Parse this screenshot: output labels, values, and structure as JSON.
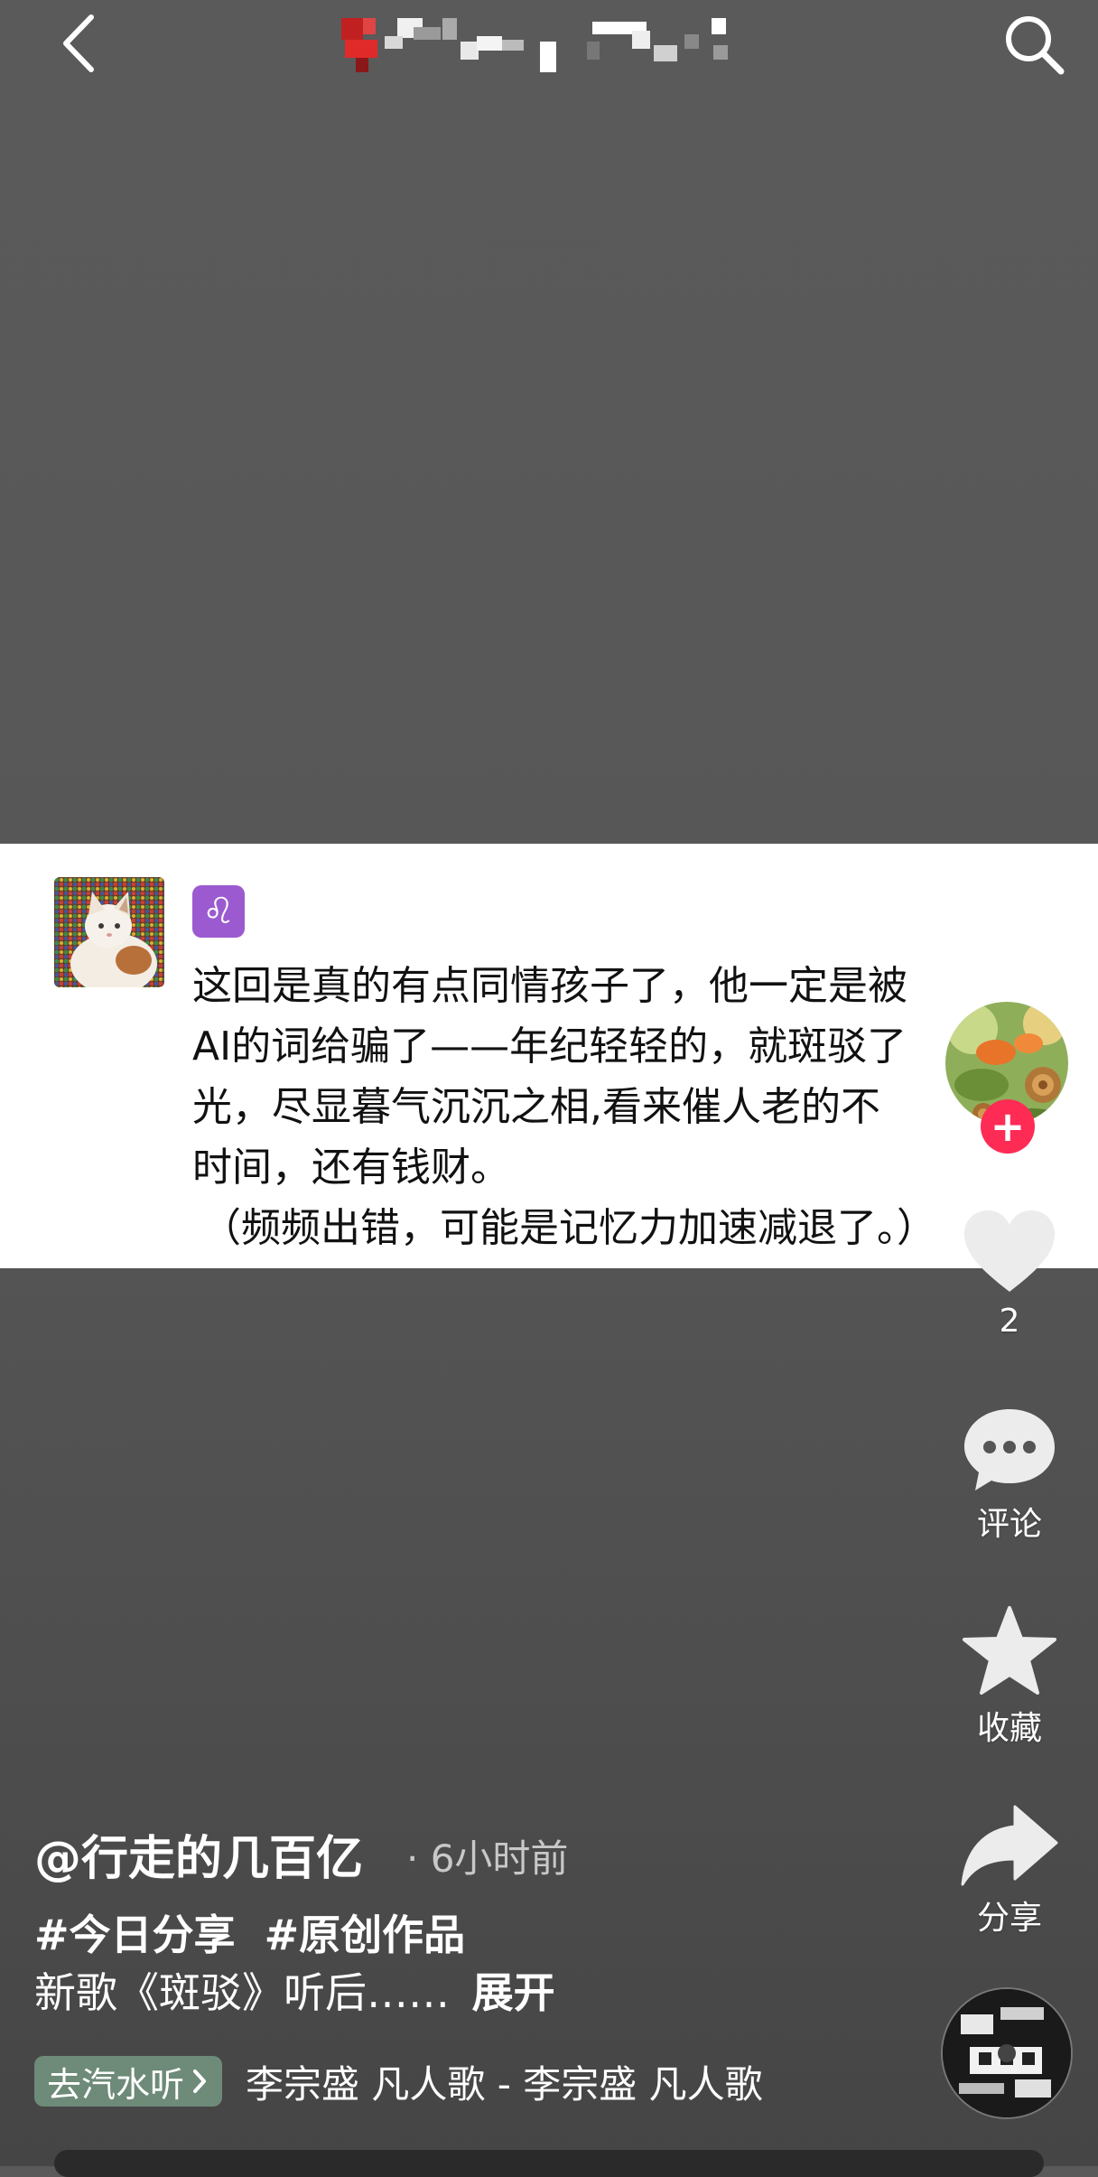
{
  "top_bar": {
    "back_icon": "chevron-left-icon",
    "search_icon": "search-icon"
  },
  "card": {
    "zodiac_symbol": "♌",
    "lines": [
      "这回是真的有点同情孩子了，他一定是被",
      "AI的词给骗了——年纪轻轻的，就斑驳了",
      "光，尽显暮气沉沉之相,看来催人老的不",
      "时间，还有钱财。",
      "（频频出错，可能是记忆力加速减退了。）"
    ]
  },
  "rail": {
    "like_count": "2",
    "comment_label": "评论",
    "favorite_label": "收藏",
    "share_label": "分享",
    "follow_symbol": "+"
  },
  "post": {
    "author": "@行走的几百亿",
    "time": "· 6小时前",
    "hashtags": [
      "#今日分享",
      "#原创作品"
    ],
    "description": "新歌《斑驳》听后……",
    "expand_label": "展开"
  },
  "music": {
    "soda_label": "去汽水听",
    "track_text": "李宗盛    凡人歌 - 李宗盛    凡人歌"
  },
  "colors": {
    "follow": "#fe2c55",
    "soda_bg": "#6e8a78",
    "zodiac_bg": "#9c5ad0"
  }
}
